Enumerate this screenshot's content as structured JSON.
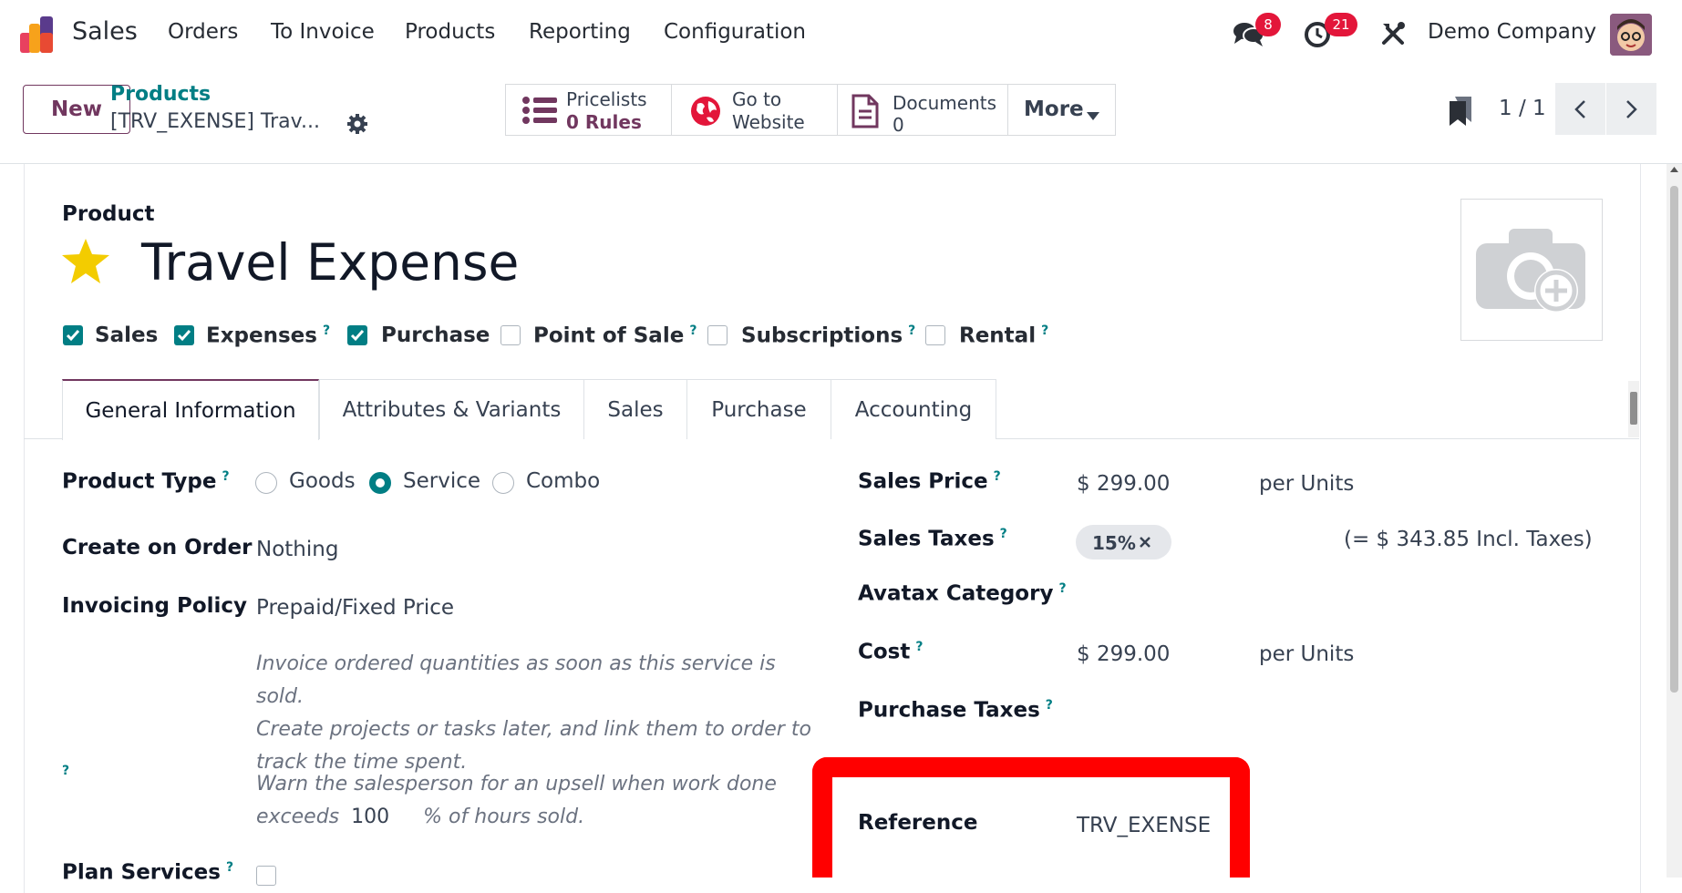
{
  "nav": {
    "app_name": "Sales",
    "menu": [
      "Orders",
      "To Invoice",
      "Products",
      "Reporting",
      "Configuration"
    ],
    "messages_count": "8",
    "activities_count": "21",
    "company": "Demo Company"
  },
  "control": {
    "new_label": "New",
    "breadcrumb_parent": "Products",
    "breadcrumb_current": "[TRV_EXENSE] Trav...",
    "smart_buttons": {
      "pricelists_label": "Pricelists",
      "pricelists_value": "0 Rules",
      "website_line1": "Go to",
      "website_line2": "Website",
      "documents_label": "Documents",
      "documents_value": "0",
      "more_label": "More"
    },
    "pager": "1 / 1"
  },
  "form": {
    "type_label": "Product",
    "name": "Travel Expense",
    "flags": [
      {
        "label": "Sales",
        "checked": true,
        "help": false
      },
      {
        "label": "Expenses",
        "checked": true,
        "help": true
      },
      {
        "label": "Purchase",
        "checked": true,
        "help": false
      },
      {
        "label": "Point of Sale",
        "checked": false,
        "help": true
      },
      {
        "label": "Subscriptions",
        "checked": false,
        "help": true
      },
      {
        "label": "Rental",
        "checked": false,
        "help": true
      }
    ],
    "tabs": [
      "General Information",
      "Attributes & Variants",
      "Sales",
      "Purchase",
      "Accounting"
    ],
    "product_type_label": "Product Type",
    "product_type_options": [
      "Goods",
      "Service",
      "Combo"
    ],
    "product_type_selected": "Service",
    "create_on_order_label": "Create on Order",
    "create_on_order_value": "Nothing",
    "invoicing_policy_label": "Invoicing Policy",
    "invoicing_policy_value": "Prepaid/Fixed Price",
    "invoicing_help_1": "Invoice ordered quantities as soon as this service is sold.",
    "invoicing_help_2": "Create projects or tasks later, and link them to order to",
    "invoicing_help_3": "track the time spent.",
    "upsell_text_1": "Warn the salesperson for an upsell when work done",
    "upsell_text_2a": "exceeds",
    "upsell_value": "100",
    "upsell_text_2b": "% of hours sold.",
    "plan_services_label": "Plan Services",
    "sales_price_label": "Sales Price",
    "sales_price_value": "$ 299.00",
    "sales_price_unit": "per Units",
    "sales_taxes_label": "Sales Taxes",
    "sales_tax_tag": "15%",
    "sales_taxes_incl": "(= $ 343.85 Incl. Taxes)",
    "avatax_label": "Avatax Category",
    "cost_label": "Cost",
    "cost_value": "$ 299.00",
    "cost_unit": "per Units",
    "purchase_taxes_label": "Purchase Taxes",
    "reference_label": "Reference",
    "reference_value": "TRV_EXENSE"
  },
  "colors": {
    "brand": "#71375f",
    "accent": "#017e84",
    "highlight": "#ff0000"
  }
}
